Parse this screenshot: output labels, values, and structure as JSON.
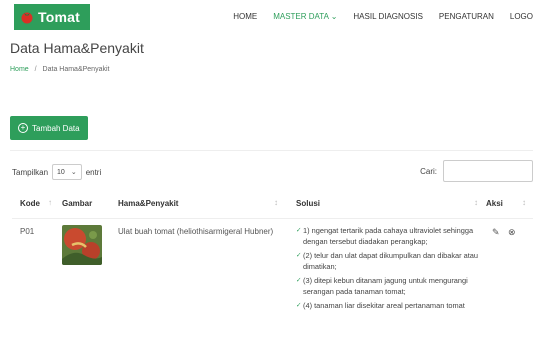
{
  "header": {
    "brand": "Tomat",
    "nav": [
      "HOME",
      "MASTER DATA",
      "HASIL DIAGNOSIS",
      "PENGATURAN",
      "LOGO"
    ],
    "active_nav": "MASTER DATA",
    "brand_color": "#2e9e5b"
  },
  "page": {
    "title": "Data Hama&Penyakit",
    "breadcrumb": {
      "home": "Home",
      "current": "Data Hama&Penyakit"
    }
  },
  "toolbar": {
    "add_label": "Tambah Data"
  },
  "table_controls": {
    "length_prefix": "Tampilkan",
    "length_value": "10",
    "length_suffix": "entri",
    "search_label": "Cari:"
  },
  "table": {
    "columns": [
      "Kode",
      "Gambar",
      "Hama&Penyakit",
      "Solusi",
      "Aksi"
    ],
    "rows": [
      {
        "kode": "P01",
        "image_icon": "tomato-fruitworm-photo",
        "name": "Ulat buah tomat (heliothisarmigeral Hubner)",
        "solusi": [
          "1) ngengat tertarik pada cahaya ultraviolet sehingga dengan tersebut diadakan perangkap;",
          "(2) telur dan ulat dapat dikumpulkan dan dibakar atau dimatikan;",
          "(3) ditepi kebun ditanam jagung untuk mengurangi serangan pada tanaman tomat;",
          "(4) tanaman liar disekitar areal pertanaman tomat"
        ],
        "actions": [
          "edit-icon",
          "delete-icon"
        ]
      }
    ]
  }
}
